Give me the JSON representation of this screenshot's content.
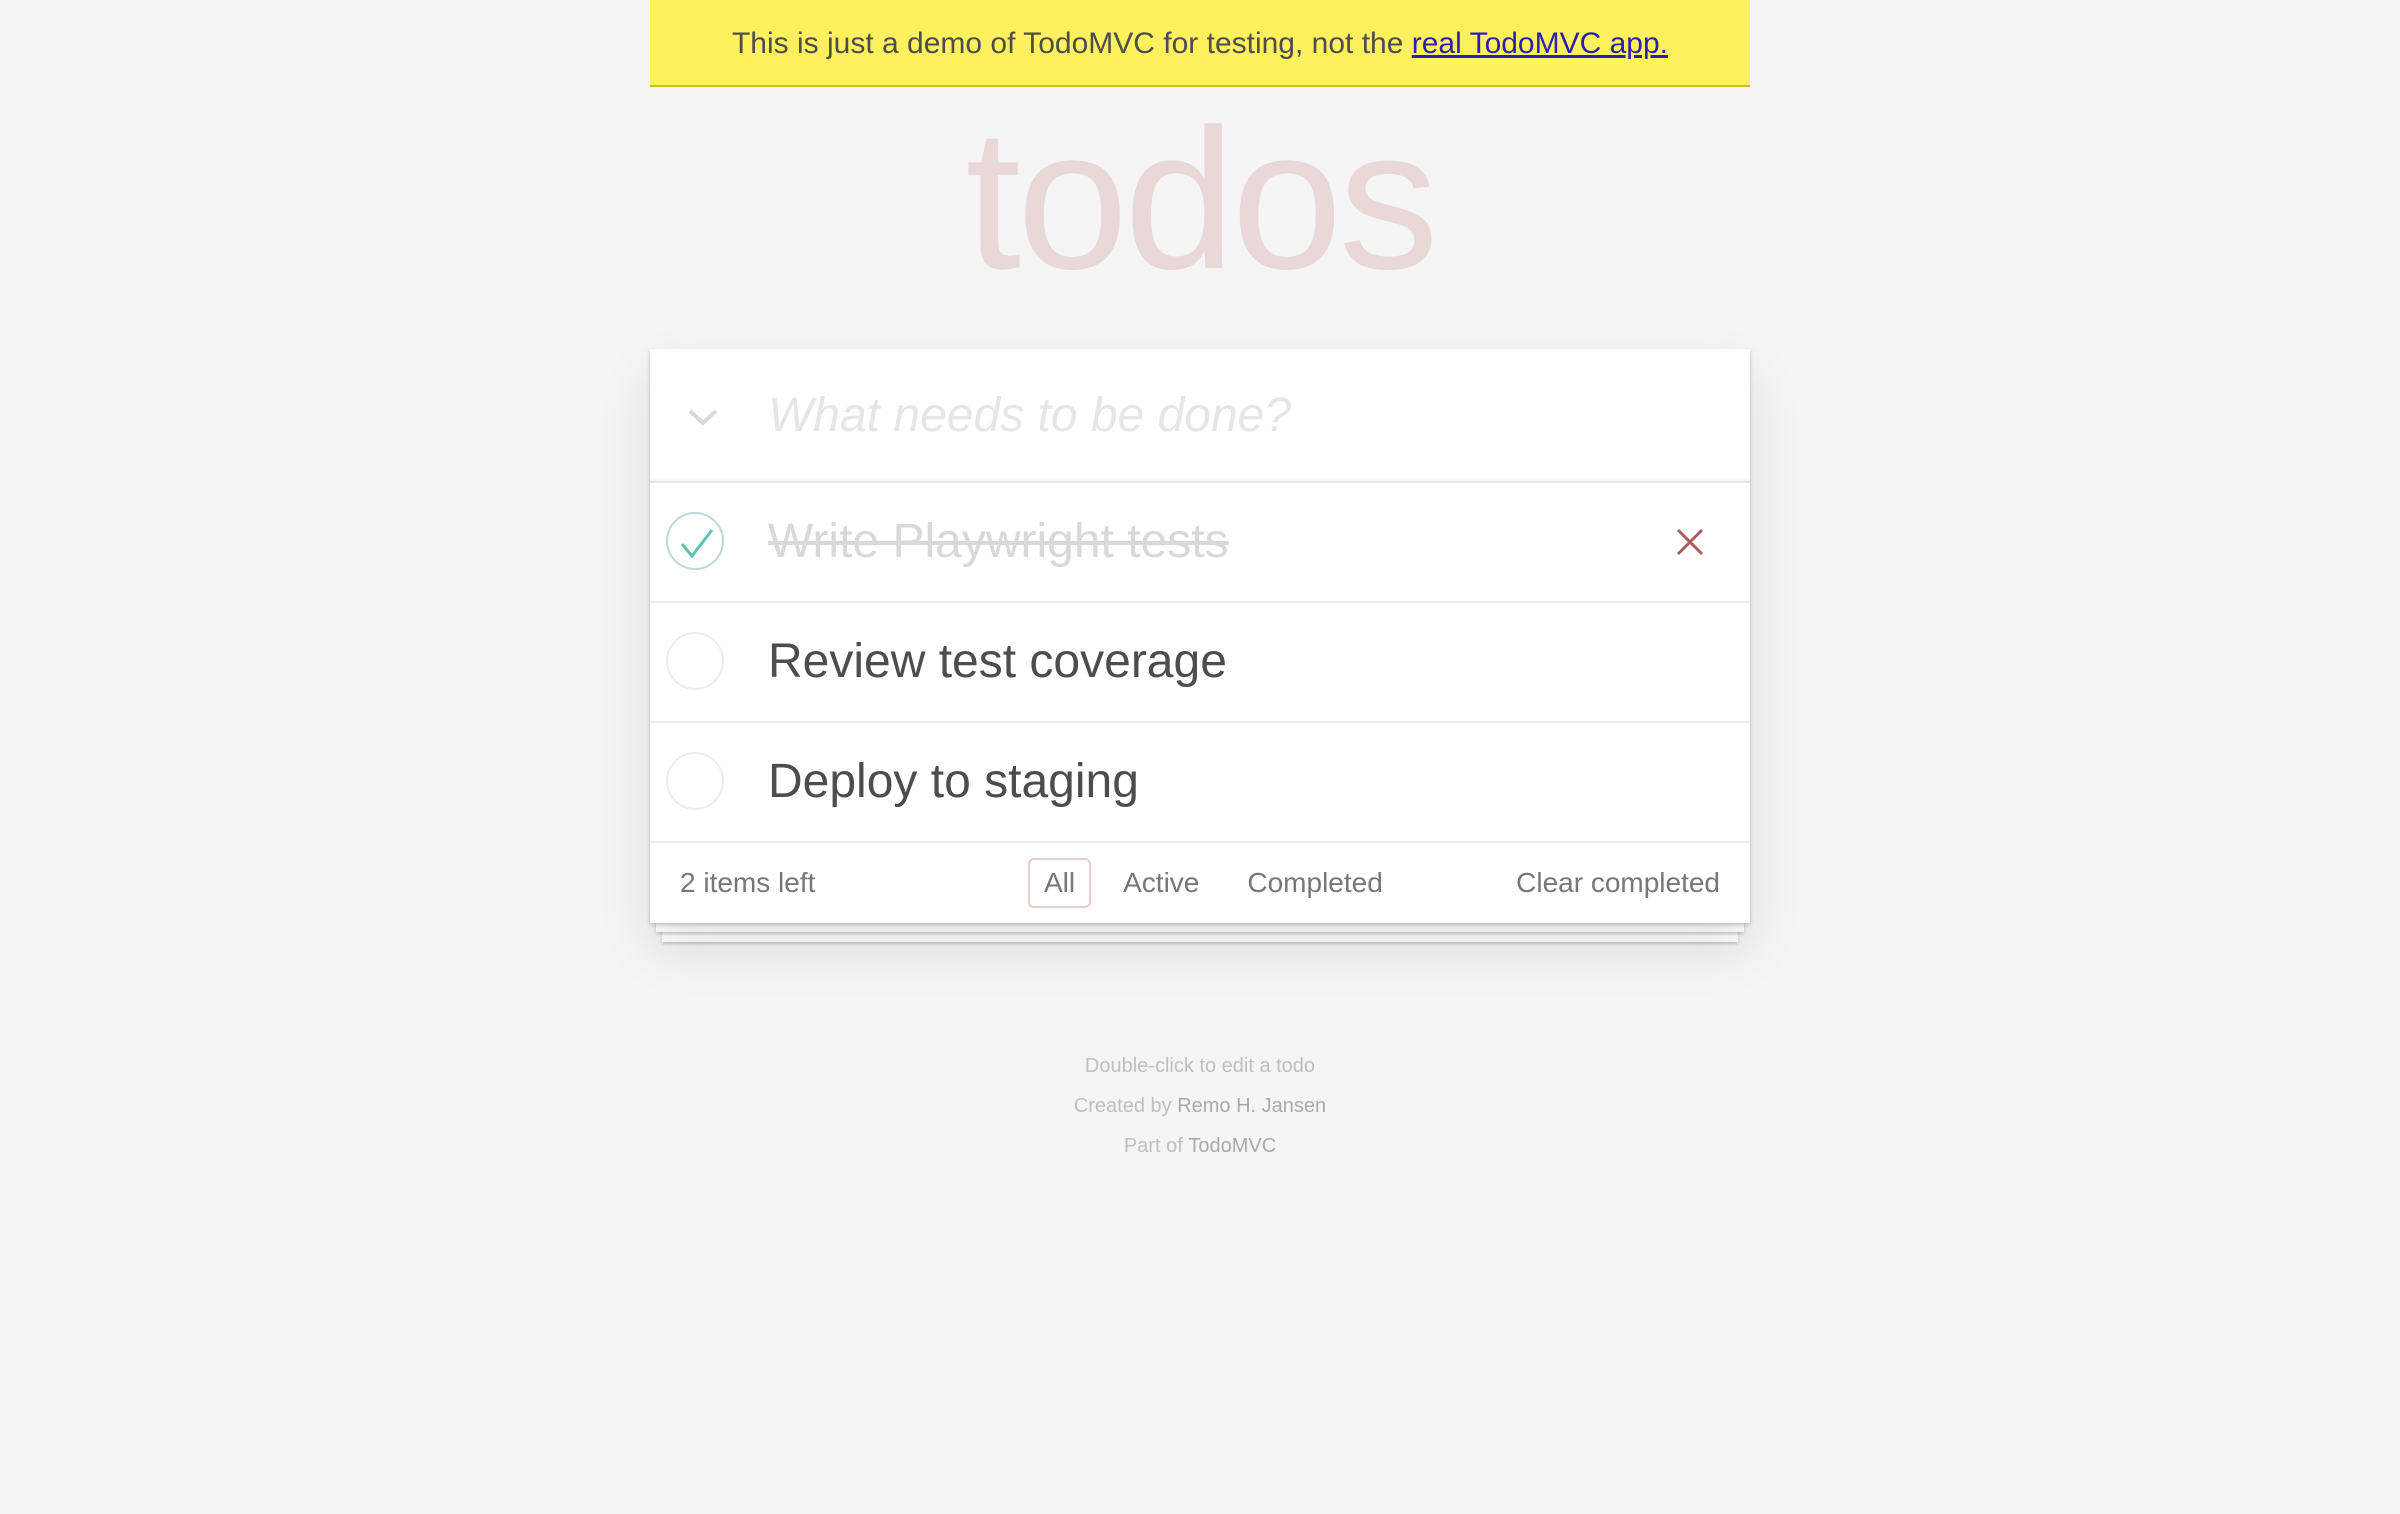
{
  "banner": {
    "text": "This is just a demo of TodoMVC for testing, not the ",
    "link_label": "real TodoMVC app."
  },
  "app": {
    "title": "todos"
  },
  "new_todo": {
    "placeholder": "What needs to be done?",
    "value": "",
    "toggle_all_icon": "chevron-down-icon"
  },
  "todos": [
    {
      "label": "Write Playwright tests",
      "completed": true
    },
    {
      "label": "Review test coverage",
      "completed": false
    },
    {
      "label": "Deploy to staging",
      "completed": false
    }
  ],
  "footer": {
    "count_label": "2 items left",
    "filters": [
      {
        "label": "All",
        "selected": true
      },
      {
        "label": "Active",
        "selected": false
      },
      {
        "label": "Completed",
        "selected": false
      }
    ],
    "clear_label": "Clear completed"
  },
  "info": {
    "hint": "Double-click to edit a todo",
    "created_prefix": "Created by ",
    "created_name": "Remo H. Jansen",
    "part_prefix": "Part of ",
    "part_name": "TodoMVC"
  },
  "colors": {
    "banner_bg": "#fff05e",
    "check_green": "#5dc2af",
    "destroy_red": "#af5b5e",
    "title_color": "rgba(175, 47, 47, 0.15)"
  }
}
